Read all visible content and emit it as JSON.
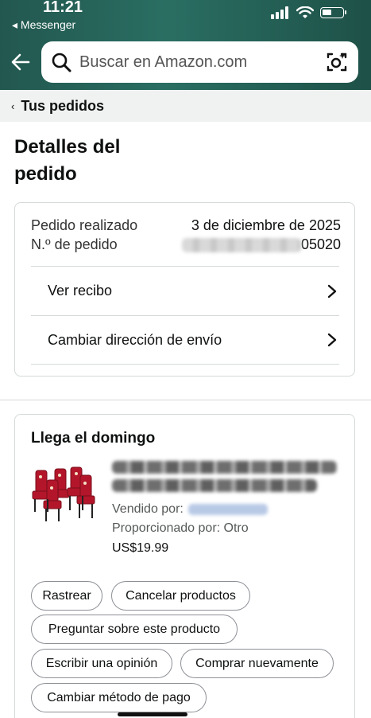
{
  "status_bar": {
    "time": "11:21",
    "back_app": "◂ Messenger"
  },
  "search": {
    "placeholder": "Buscar en Amazon.com"
  },
  "breadcrumb": {
    "label": "Tus pedidos"
  },
  "page": {
    "title": "Detalles del pedido"
  },
  "order_info": {
    "placed_label": "Pedido realizado",
    "placed_value": "3 de diciembre de 2025",
    "number_label": "N.º de pedido",
    "number_visible_suffix": "05020",
    "links": [
      {
        "label": "Ver recibo"
      },
      {
        "label": "Cambiar dirección de envío"
      }
    ]
  },
  "shipment": {
    "delivery_title": "Llega el domingo",
    "sold_by_label": "Vendido por:",
    "provided_by": "Proporcionado por: Otro",
    "price": "US$19.99",
    "actions": [
      {
        "label": "Rastrear"
      },
      {
        "label": "Cancelar productos"
      },
      {
        "label": "Preguntar sobre este producto"
      },
      {
        "label": "Escribir una opinión"
      },
      {
        "label": "Comprar nuevamente"
      },
      {
        "label": "Cambiar método de pago"
      }
    ]
  },
  "colors": {
    "header_bg": "#2a6e62",
    "breadcrumb_bg": "#f0f2f2",
    "border": "#d5d9d9",
    "text": "#0f1111",
    "secondary_text": "#565959",
    "product_red": "#b3162a"
  },
  "icons": [
    "back-arrow-icon",
    "search-icon",
    "camera-icon",
    "chevron-right-icon",
    "signal-icon",
    "wifi-icon",
    "battery-icon"
  ]
}
